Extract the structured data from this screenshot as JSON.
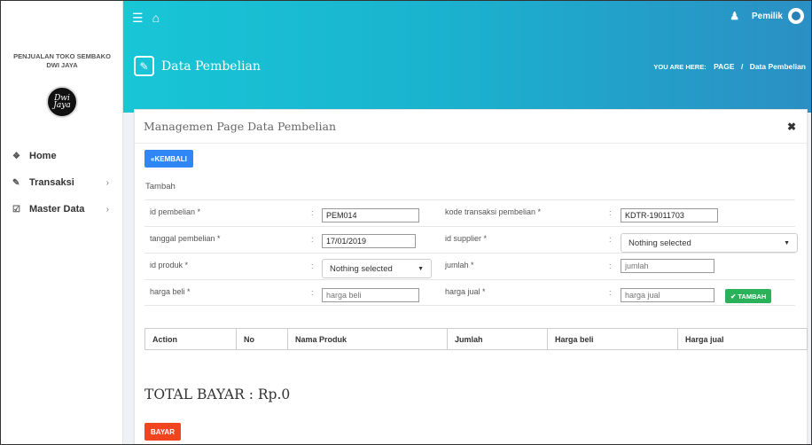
{
  "sidebar": {
    "brand_line1": "PENJUALAN TOKO SEMBAKO",
    "brand_line2": "DWI JAYA",
    "logo_text1": "Dwi",
    "logo_text2": "Jaya",
    "items": [
      {
        "label": "Home",
        "icon": "home-icon",
        "has_chevron": false
      },
      {
        "label": "Transaksi",
        "icon": "pencil-icon",
        "has_chevron": true
      },
      {
        "label": "Master Data",
        "icon": "edit-icon",
        "has_chevron": true
      }
    ]
  },
  "header": {
    "user_name": "Pemilik",
    "page_title": "Data Pembelian",
    "breadcrumb_prefix": "YOU ARE HERE:",
    "breadcrumb_page": "PAGE",
    "breadcrumb_sep": "/",
    "breadcrumb_current": "Data Pembelian"
  },
  "card": {
    "title": "Managemen Page Data Pembelian",
    "back_label": "KEMBALI",
    "subtitle": "Tambah"
  },
  "form": {
    "id_pembelian_label": "id pembelian *",
    "id_pembelian_value": "PEM014",
    "kode_transaksi_label": "kode transaksi pembelian *",
    "kode_transaksi_value": "KDTR-19011703",
    "tanggal_label": "tanggal pembelian *",
    "tanggal_value": "17/01/2019",
    "id_supplier_label": "id supplier *",
    "id_supplier_value": "Nothing selected",
    "id_produk_label": "id produk *",
    "id_produk_value": "Nothing selected",
    "jumlah_label": "jumlah *",
    "jumlah_placeholder": "jumlah",
    "harga_beli_label": "harga beli *",
    "harga_beli_placeholder": "harga beli",
    "harga_jual_label": "harga jual *",
    "harga_jual_placeholder": "harga jual",
    "tambah_label": "TAMBAH",
    "colon": ":"
  },
  "table": {
    "columns": [
      "Action",
      "No",
      "Nama Produk",
      "Jumlah",
      "Harga beli",
      "Harga jual"
    ]
  },
  "total_label": "TOTAL BAYAR : Rp.0",
  "bayar_label": "BAYAR",
  "colors": {
    "header_start": "#18c6d6",
    "header_end": "#2b8fc4",
    "primary_button": "#2f86f4",
    "success_button": "#2bb15a",
    "danger_button": "#f0451e"
  }
}
